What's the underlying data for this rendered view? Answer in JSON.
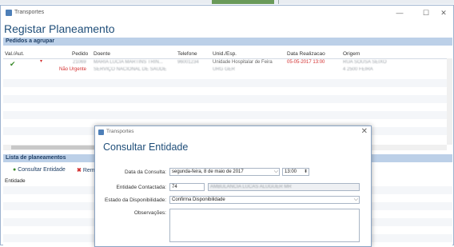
{
  "window": {
    "title": "Transportes",
    "header": "Registar Planeamento",
    "minimize": "—",
    "maximize": "☐",
    "close": "✕"
  },
  "pedidos": {
    "section_title": "Pedidos a agrupar",
    "columns": {
      "val": "Val./Aut.",
      "pedido": "Pedido",
      "doente": "Doente",
      "telefone": "Telefone",
      "unid": "Unid./Esp.",
      "data": "Data Realizacao",
      "origem": "Origem"
    },
    "row": {
      "pedido": "21069",
      "status": "Não Urgente",
      "doente": "MARIA LUCIA MARTINS TRIN...",
      "doente2": "SERVIÇO NACIONAL DE SAUDE",
      "telefone": "96001234",
      "unid": "Unidade Hospitalar de Feira",
      "unid2": "URG GER",
      "data": "05-05-2017 13:00",
      "origem": "RUA SOUSA SEIXO",
      "origem2": "4 2500 FEIRA"
    }
  },
  "planeamentos": {
    "section_title": "Lista de planeamentos",
    "consultar_label": "Consultar Entidade",
    "remove_label": "Rem",
    "col_entidade": "Entidade"
  },
  "dialog": {
    "title": "Transportes",
    "header": "Consultar Entidade",
    "close": "✕",
    "date_label": "Data da Consulta:",
    "date_value": "segunda-feira,  8 de    maio    de 2017",
    "time_value": "13:00",
    "entidade_label": "Entidade Contactada:",
    "entidade_code": "74",
    "entidade_name": "AMBULANCIA LUCAS ALUGUER MR",
    "estado_label": "Estado da Disponibilidade:",
    "estado_value": "Confirma Disponibilidade",
    "obs_label": "Observações:",
    "obs_value": ""
  },
  "colors": {
    "accent": "#1f4e79",
    "section": "#bcd0e8",
    "urgent": "#d32f2f"
  },
  "icons": [
    "app-icon",
    "check-icon",
    "consult-icon",
    "remove-icon",
    "calendar-icon",
    "chevron-down-icon"
  ]
}
